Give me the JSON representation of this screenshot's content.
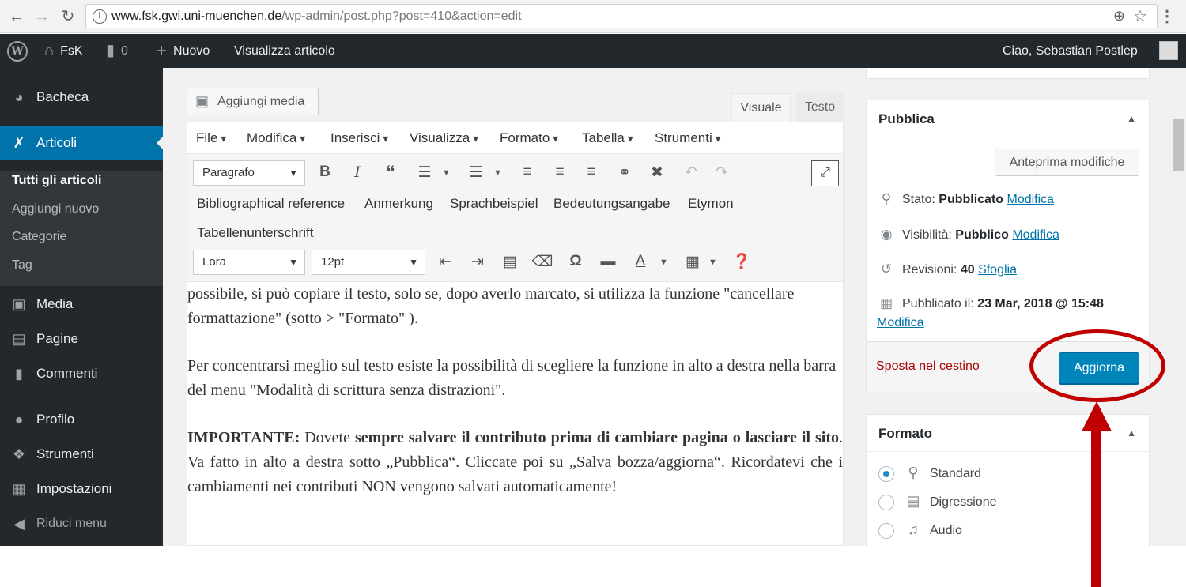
{
  "browser": {
    "url_host": "www.fsk.gwi.uni-muenchen.de",
    "url_path": "/wp-admin/post.php?post=410&action=edit"
  },
  "adminbar": {
    "site_name": "FsK",
    "comments_count": "0",
    "new_label": "Nuovo",
    "view_post_label": "Visualizza articolo",
    "greeting": "Ciao, Sebastian Postlep"
  },
  "sidebar": {
    "items": [
      {
        "label": "Bacheca"
      },
      {
        "label": "Articoli"
      },
      {
        "label": "Media"
      },
      {
        "label": "Pagine"
      },
      {
        "label": "Commenti"
      },
      {
        "label": "Profilo"
      },
      {
        "label": "Strumenti"
      },
      {
        "label": "Impostazioni"
      },
      {
        "label": "Riduci menu"
      }
    ],
    "submenu": [
      {
        "label": "Tutti gli articoli"
      },
      {
        "label": "Aggiungi nuovo"
      },
      {
        "label": "Categorie"
      },
      {
        "label": "Tag"
      }
    ]
  },
  "editor": {
    "add_media_label": "Aggiungi media",
    "tabs": {
      "visual": "Visuale",
      "text": "Testo"
    },
    "menubar": [
      "File",
      "Modifica",
      "Inserisci",
      "Visualizza",
      "Formato",
      "Tabella",
      "Strumenti"
    ],
    "paragraph_select": "Paragrafo",
    "font_select": "Lora",
    "size_select": "12pt",
    "custom_formats": [
      "Bibliographical reference",
      "Anmerkung",
      "Sprachbeispiel",
      "Bedeutungsangabe",
      "Etymon",
      "Tabellenunterschrift"
    ],
    "content": {
      "p1": "possibile, si può copiare il testo, solo se, dopo averlo marcato, si utilizza la funzione \"cancellare formattazione\" (sotto > \"Formato\" ).",
      "p2": "Per concentrarsi meglio sul testo esiste la possibilità di scegliere la funzione in alto a destra nella barra del menu \"Modalità di scrittura senza distrazioni\".",
      "p3_important": "IMPORTANTE:",
      "p3_a": " Dovete ",
      "p3_bold": "sempre salvare il contributo prima di cambiare pagina o lasciare il sito",
      "p3_b": ". Va fatto in alto a destra sotto „Pubblica“. Cliccate poi su „Salva bozza/aggiorna“. Ricordatevi che i cambiamenti nei contributi NON vengono salvati automaticamente!"
    }
  },
  "publish": {
    "title": "Pubblica",
    "preview_label": "Anteprima modifiche",
    "status_label": "Stato:",
    "status_value": "Pubblicato",
    "visibility_label": "Visibilità:",
    "visibility_value": "Pubblico",
    "revisions_label": "Revisioni:",
    "revisions_value": "40",
    "browse_label": "Sfoglia",
    "published_label": "Pubblicato il:",
    "published_value": "23 Mar, 2018 @ 15:48",
    "edit_label": "Modifica",
    "trash_label": "Sposta nel cestino",
    "update_label": "Aggiorna"
  },
  "format": {
    "title": "Formato",
    "options": [
      "Standard",
      "Digressione",
      "Audio"
    ],
    "selected": "Standard"
  },
  "colors": {
    "adminbar": "#23282d",
    "accent": "#0073aa",
    "button_primary": "#0085ba",
    "annotation": "#c00000"
  }
}
